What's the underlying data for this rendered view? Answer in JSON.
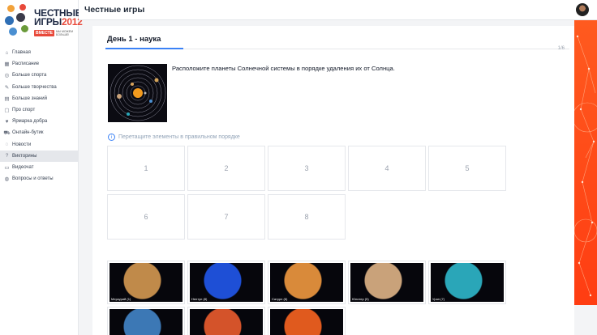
{
  "app": {
    "title": "Честные игры"
  },
  "logo": {
    "line1": "ЧЕСТНЫЕ",
    "line2": "ИГРЫ",
    "year": "2012",
    "badge": "ВМЕСТЕ",
    "small": "МЫ МОЖЕМ БОЛЬШЕ!"
  },
  "sidebar": {
    "items": [
      {
        "label": "Главная",
        "icon": "home-icon",
        "glyph": "⌂"
      },
      {
        "label": "Расписание",
        "icon": "calendar-icon",
        "glyph": "▦"
      },
      {
        "label": "Больше спорта",
        "icon": "sport-icon",
        "glyph": "◎"
      },
      {
        "label": "Больше творчества",
        "icon": "creative-icon",
        "glyph": "✎"
      },
      {
        "label": "Больше знаний",
        "icon": "book-icon",
        "glyph": "▤"
      },
      {
        "label": "Про спорт",
        "icon": "document-icon",
        "glyph": "▢"
      },
      {
        "label": "Ярмарка добра",
        "icon": "gift-icon",
        "glyph": "♥"
      },
      {
        "label": "Онлайн-бутик",
        "icon": "cart-icon",
        "glyph": "⛟"
      },
      {
        "label": "Новости",
        "icon": "news-icon",
        "glyph": "◌"
      },
      {
        "label": "Викторины",
        "icon": "quiz-icon",
        "glyph": "?"
      },
      {
        "label": "Видеочат",
        "icon": "video-icon",
        "glyph": "▭"
      },
      {
        "label": "Вопросы и ответы",
        "icon": "faq-icon",
        "glyph": "◍"
      }
    ],
    "active_index": 9
  },
  "quiz": {
    "title": "День 1 - наука",
    "counter": "1/6",
    "progress": 0.167,
    "question": "Расположите планеты Солнечной системы в порядке удаления их от Солнца.",
    "hint": "Перетащите элементы в правильном порядке",
    "slots": [
      "1",
      "2",
      "3",
      "4",
      "5",
      "6",
      "7",
      "8"
    ],
    "options": [
      {
        "label": "Меркурий (1)",
        "color": "#c08a4a"
      },
      {
        "label": "Нептун (8)",
        "color": "#1e4fd6"
      },
      {
        "label": "Сатурн (6)",
        "color": "#d98a3a"
      },
      {
        "label": "Юпитер (5)",
        "color": "#c9a27a"
      },
      {
        "label": "Уран (7)",
        "color": "#2aa6b8"
      },
      {
        "label": "",
        "color": "#3c78b5"
      },
      {
        "label": "",
        "color": "#d4532a"
      },
      {
        "label": "",
        "color": "#e05a1e"
      }
    ]
  },
  "colors": {
    "accent": "#3b82f6",
    "brand_orange": "#ff4a1a",
    "logo_red": "#e8493a"
  }
}
